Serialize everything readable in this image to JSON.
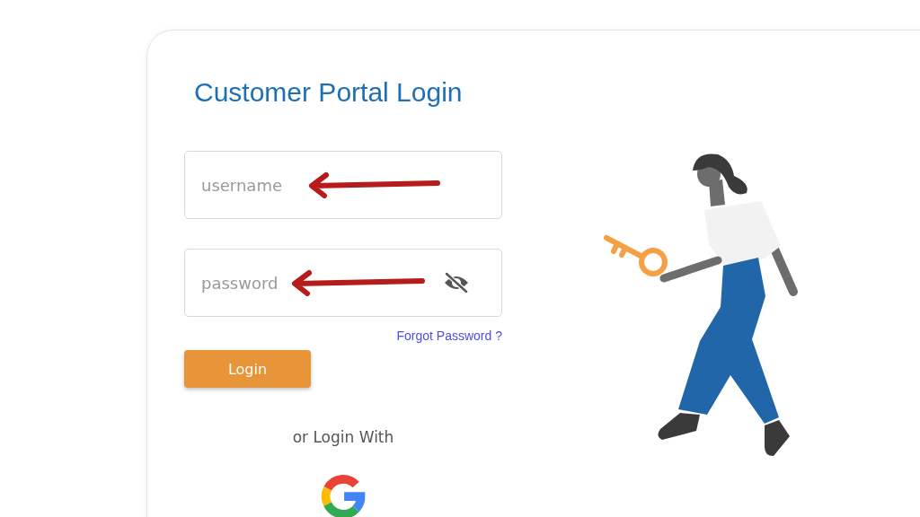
{
  "title": "Customer Portal Login",
  "username_field": {
    "placeholder": "username"
  },
  "password_field": {
    "placeholder": "password"
  },
  "forgot_password_link": "Forgot Password ?",
  "login_button": "Login",
  "alt_login_label": "or Login With"
}
